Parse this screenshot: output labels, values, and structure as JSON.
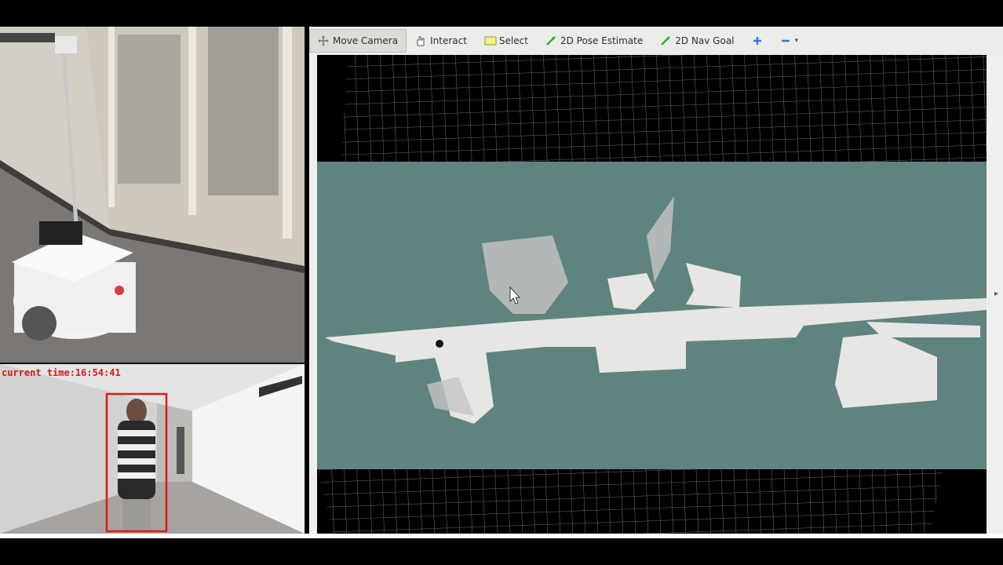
{
  "toolbar": {
    "tools": [
      {
        "label": "Move Camera",
        "icon": "move-camera-icon",
        "active": true
      },
      {
        "label": "Interact",
        "icon": "hand-icon"
      },
      {
        "label": "Select",
        "icon": "select-icon"
      },
      {
        "label": "2D Pose Estimate",
        "icon": "pose-arrow-icon"
      },
      {
        "label": "2D Nav Goal",
        "icon": "nav-goal-arrow-icon"
      }
    ],
    "add_icon": "plus-icon",
    "remove_icon": "minus-icon"
  },
  "person_camera": {
    "time_text": "current time:16:54:41"
  },
  "colors": {
    "map_unknown": "#5f8480",
    "map_free": "#e6e6e4",
    "tracking_box": "#e01818"
  }
}
